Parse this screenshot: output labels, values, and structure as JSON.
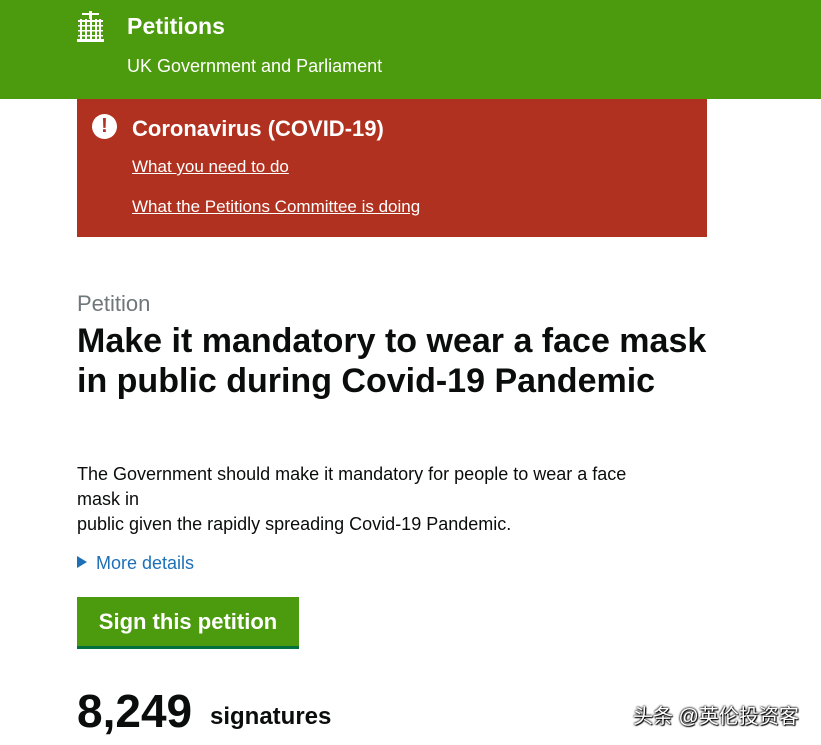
{
  "header": {
    "title": "Petitions",
    "subtitle": "UK Government and Parliament",
    "logo_icon": "portcullis-icon",
    "background": "#4c9a0e"
  },
  "alert": {
    "icon": "exclamation-icon",
    "title": "Coronavirus (COVID-19)",
    "links": [
      "What you need to do",
      "What the Petitions Committee is doing"
    ],
    "background": "#b0311f"
  },
  "petition": {
    "eyebrow": "Petition",
    "title": "Make it mandatory to wear a face mask in public during Covid-19 Pandemic",
    "summary_lines": [
      "The Government should make it mandatory for people to wear a face",
      "mask in",
      "public given the rapidly spreading Covid-19 Pandemic."
    ],
    "more_details": "More details",
    "sign_button": "Sign this petition",
    "signature_count": "8,249",
    "signature_label": "signatures"
  },
  "watermark": "头条 @英伦投资客"
}
